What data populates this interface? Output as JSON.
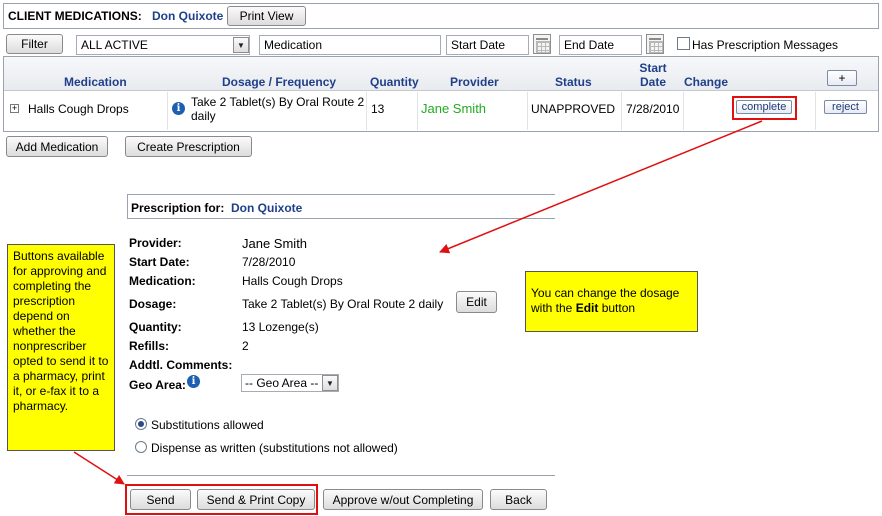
{
  "header": {
    "title": "CLIENT MEDICATIONS:",
    "client_name": "Don Quixote",
    "print_view": "Print View"
  },
  "filter_bar": {
    "filter_button": "Filter",
    "status_select": "ALL ACTIVE",
    "medication_field": "Medication",
    "start_date_field": "Start Date",
    "end_date_field": "End Date",
    "has_rx_messages": "Has Prescription Messages"
  },
  "grid": {
    "columns": {
      "medication": "Medication",
      "dosage": "Dosage / Frequency",
      "quantity": "Quantity",
      "provider": "Provider",
      "status": "Status",
      "start_date": "Start Date",
      "change": "Change"
    },
    "add_button": "+",
    "row": {
      "expand": "+",
      "medication": "Halls Cough Drops",
      "dosage": "Take 2 Tablet(s) By Oral Route 2 daily",
      "quantity": "13",
      "provider": "Jane Smith",
      "status": "UNAPPROVED",
      "start_date": "7/28/2010",
      "complete": "complete",
      "reject": "reject"
    }
  },
  "actions": {
    "add_medication": "Add Medication",
    "create_prescription": "Create Prescription"
  },
  "prescription": {
    "header_label": "Prescription for:",
    "client_name": "Don Quixote",
    "fields": {
      "provider_label": "Provider:",
      "provider_value": "Jane Smith",
      "start_date_label": "Start Date:",
      "start_date_value": "7/28/2010",
      "medication_label": "Medication:",
      "medication_value": "Halls Cough Drops",
      "dosage_label": "Dosage:",
      "dosage_value": "Take 2 Tablet(s) By Oral Route 2 daily",
      "edit_button": "Edit",
      "quantity_label": "Quantity:",
      "quantity_value": "13 Lozenge(s)",
      "refills_label": "Refills:",
      "refills_value": "2",
      "comments_label": "Addtl. Comments:",
      "geo_area_label": "Geo Area:",
      "geo_area_value": "-- Geo Area --"
    },
    "substitutions_allowed": "Substitutions allowed",
    "dispense_as_written": "Dispense as written (substitutions not allowed)",
    "buttons": {
      "send": "Send",
      "send_print": "Send & Print Copy",
      "approve": "Approve w/out Completing",
      "back": "Back"
    }
  },
  "callouts": {
    "left_note": "Buttons available for approving and completing the prescription depend on whether the nonprescriber opted to send it to a pharmacy, print it, or e-fax it to a pharmacy.",
    "right_note_prefix": "You can change the dosage with the ",
    "right_note_bold": "Edit",
    "right_note_suffix": " button"
  },
  "colors": {
    "header_blue": "#1f3f8a",
    "provider_green": "#22aa22",
    "callout_yellow": "#ffff00",
    "annotation_red": "#e01010"
  }
}
